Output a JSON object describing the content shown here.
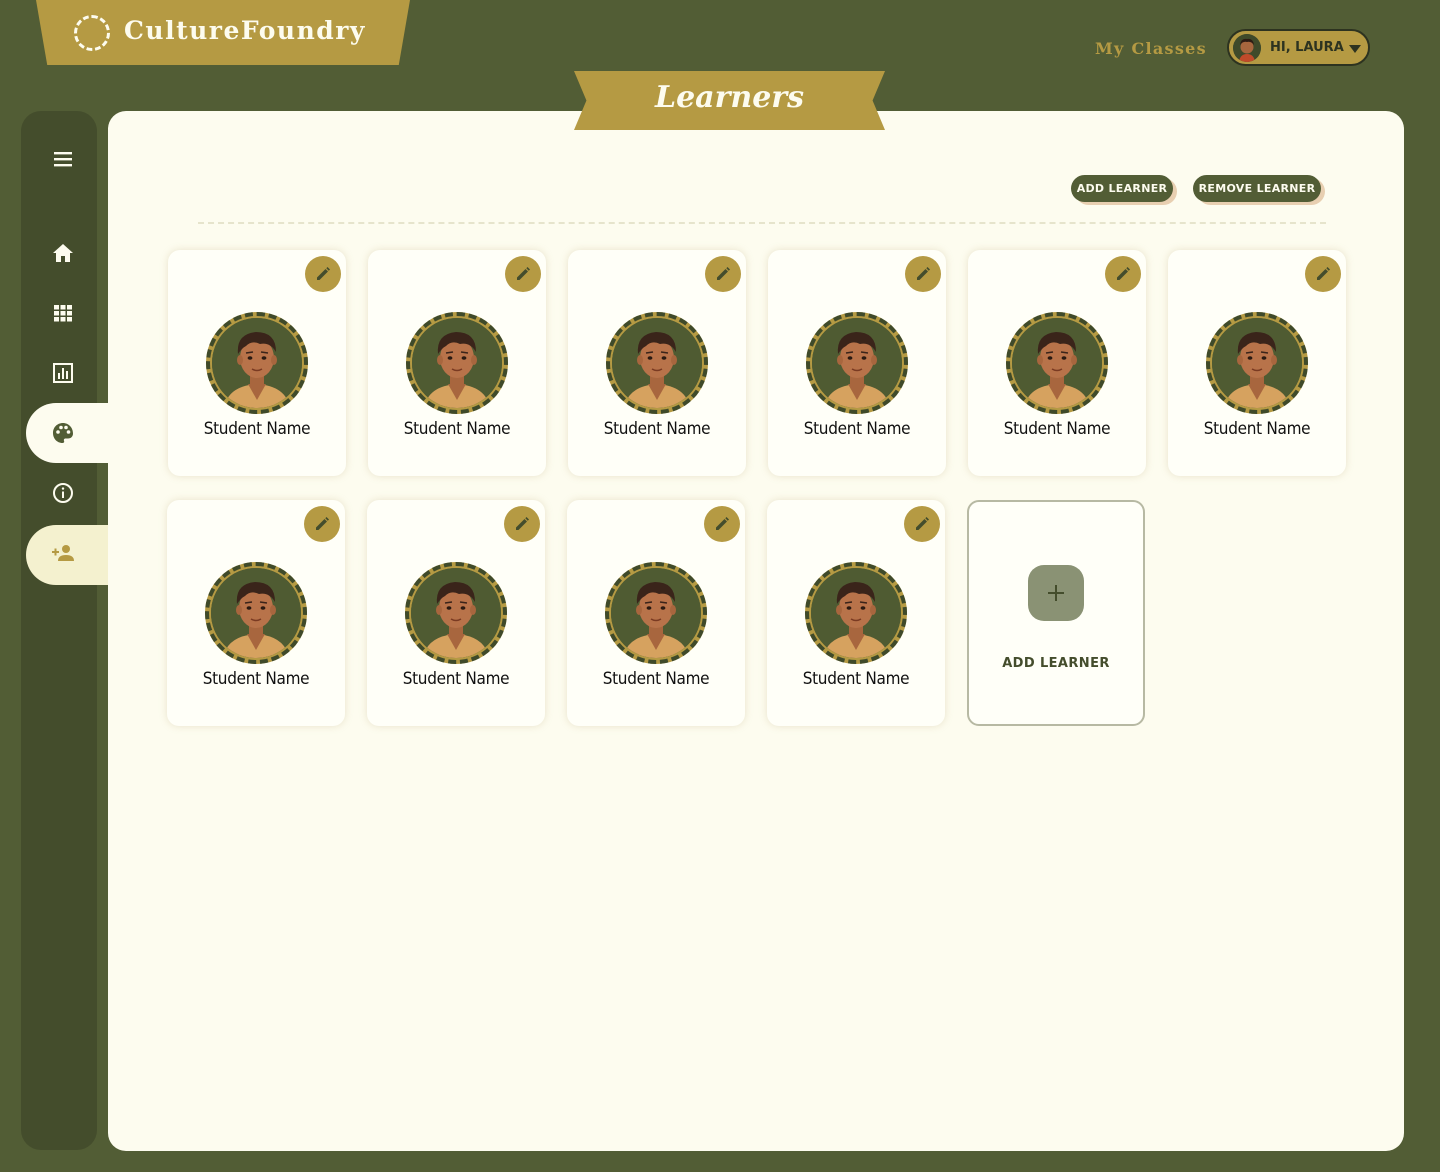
{
  "app": {
    "brand": "CultureFoundry"
  },
  "topnav": {
    "my_classes": "My Classes",
    "greeting": "HI, LAURA"
  },
  "page": {
    "title": "Learners"
  },
  "toolbar": {
    "add_learner": "ADD LEARNER",
    "remove_learner": "REMOVE LEARNER"
  },
  "sidebar": {
    "items": [
      {
        "name": "menu",
        "icon": "menu-icon"
      },
      {
        "name": "home",
        "icon": "home-icon"
      },
      {
        "name": "classes",
        "icon": "grid-icon"
      },
      {
        "name": "reports",
        "icon": "chart-icon"
      },
      {
        "name": "learners",
        "icon": "palette-icon",
        "active": true
      },
      {
        "name": "info",
        "icon": "info-icon"
      },
      {
        "name": "add-user",
        "icon": "person-add-icon"
      }
    ]
  },
  "learners": [
    {
      "name": "Student Name"
    },
    {
      "name": "Student Name"
    },
    {
      "name": "Student Name"
    },
    {
      "name": "Student Name"
    },
    {
      "name": "Student Name"
    },
    {
      "name": "Student Name"
    },
    {
      "name": "Student Name"
    },
    {
      "name": "Student Name"
    },
    {
      "name": "Student Name"
    },
    {
      "name": "Student Name"
    }
  ],
  "add_card": {
    "label": "ADD LEARNER"
  },
  "colors": {
    "background": "#525d35",
    "accent": "#b59a43",
    "panel": "#fdfcef",
    "sidebar": "#444d2c"
  }
}
